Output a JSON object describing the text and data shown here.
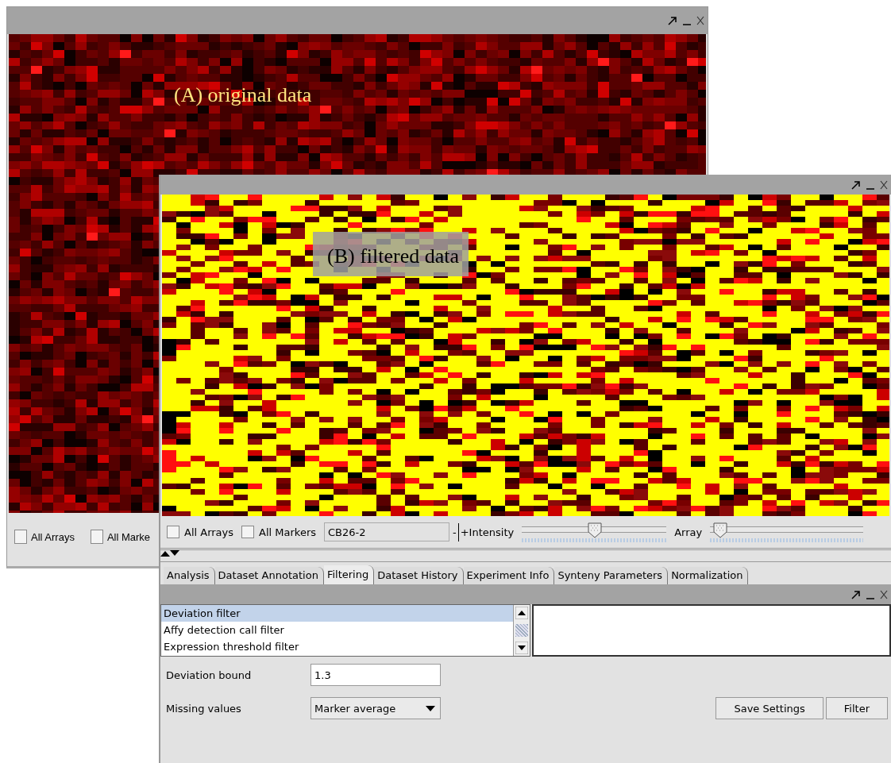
{
  "windows": [
    {
      "kind": "original",
      "overlay_label": "(A) original data",
      "toolbar": {
        "checkboxes": [
          {
            "label": "All Arrays",
            "checked": false
          },
          {
            "label": "All Marke",
            "checked": false
          }
        ]
      }
    },
    {
      "kind": "filtered",
      "overlay_label": "(B) filtered data",
      "toolbar": {
        "checkboxes": [
          {
            "label": "All Arrays",
            "checked": false
          },
          {
            "label": "All Markers",
            "checked": false
          }
        ],
        "marker_field": "CB26-2",
        "minus": "-",
        "intensity_label": "+Intensity",
        "intensity_slider": {
          "level": 0.5
        },
        "array_label": "Array",
        "array_slider": {
          "level": 0.06
        }
      },
      "tabs": [
        {
          "label": "Analysis",
          "selected": false
        },
        {
          "label": "Dataset Annotation",
          "selected": false
        },
        {
          "label": "Filtering",
          "selected": true
        },
        {
          "label": "Dataset History",
          "selected": false
        },
        {
          "label": "Experiment Info",
          "selected": false
        },
        {
          "label": "Synteny Parameters",
          "selected": false
        },
        {
          "label": "Normalization",
          "selected": false
        }
      ],
      "filter_panel": {
        "filters": [
          {
            "label": "Deviation filter",
            "selected": true
          },
          {
            "label": "Affy detection call filter",
            "selected": false
          },
          {
            "label": "Expression threshold filter",
            "selected": false
          }
        ],
        "deviation_bound": {
          "label": "Deviation bound",
          "value": "1.3"
        },
        "missing_values": {
          "label": "Missing values",
          "value": "Marker average"
        },
        "buttons": [
          "Save Settings",
          "Filter"
        ]
      }
    }
  ]
}
